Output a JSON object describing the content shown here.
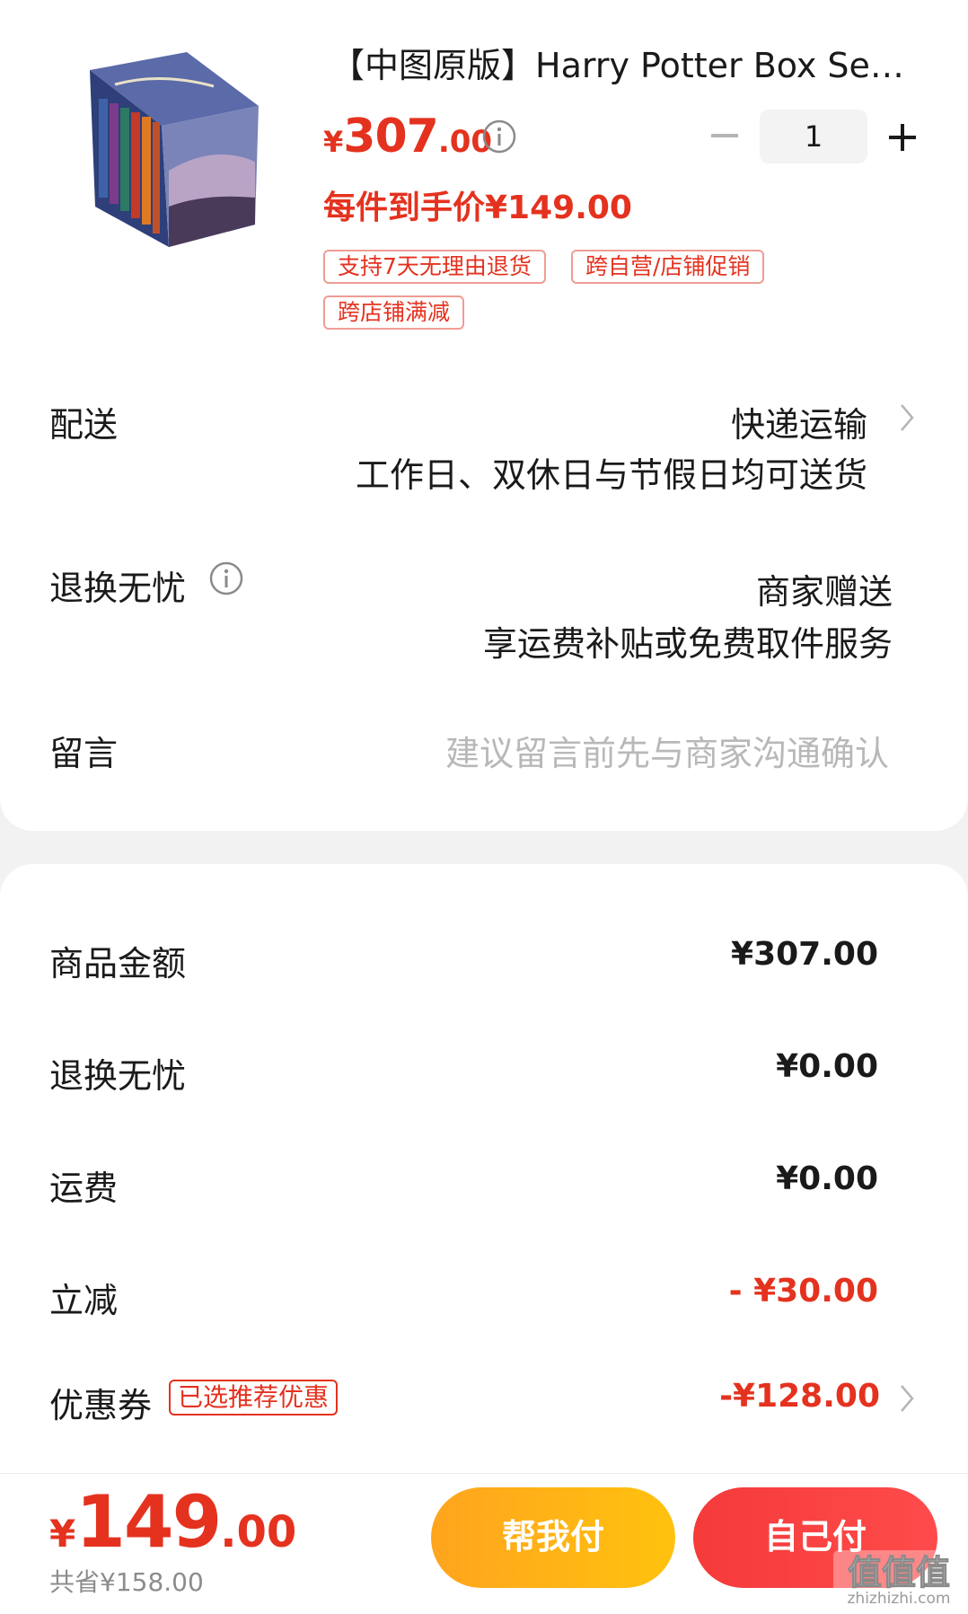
{
  "product": {
    "title": "【中图原版】Harry Potter Box Set ...",
    "price_currency": "¥",
    "price_int": "307",
    "price_dec": ".00",
    "quantity": "1",
    "deal_price": "每件到手价¥149.00",
    "tags": [
      "支持7天无理由退货",
      "跨自营/店铺促销",
      "跨店铺满减"
    ],
    "image_icon": "book-box-set-image"
  },
  "delivery": {
    "label": "配送",
    "method": "快递运输",
    "note": "工作日、双休日与节假日均可送货"
  },
  "returns": {
    "label": "退换无忧",
    "value": "商家赠送",
    "note": "享运费补贴或免费取件服务"
  },
  "message": {
    "label": "留言",
    "placeholder": "建议留言前先与商家沟通确认"
  },
  "summary": {
    "rows": [
      {
        "label": "商品金额",
        "value": "¥307.00"
      },
      {
        "label": "退换无忧",
        "value": "¥0.00"
      },
      {
        "label": "运费",
        "value": "¥0.00"
      },
      {
        "label": "立减",
        "value": "- ¥30.00"
      },
      {
        "label": "优惠券",
        "value": "-¥128.00"
      }
    ],
    "coupon_badge": "已选推荐优惠"
  },
  "bottom": {
    "currency": "¥",
    "total_int": "149",
    "total_dec": ".00",
    "saved": "共省¥158.00",
    "help_pay": "帮我付",
    "self_pay": "自己付"
  },
  "watermark": {
    "text": "zhizhizhi.com",
    "logo_glyphs": "值值值"
  },
  "colors": {
    "accent_red": "#e4321f",
    "button_red": "#f53a3a",
    "button_orange": "#ffa41e"
  }
}
